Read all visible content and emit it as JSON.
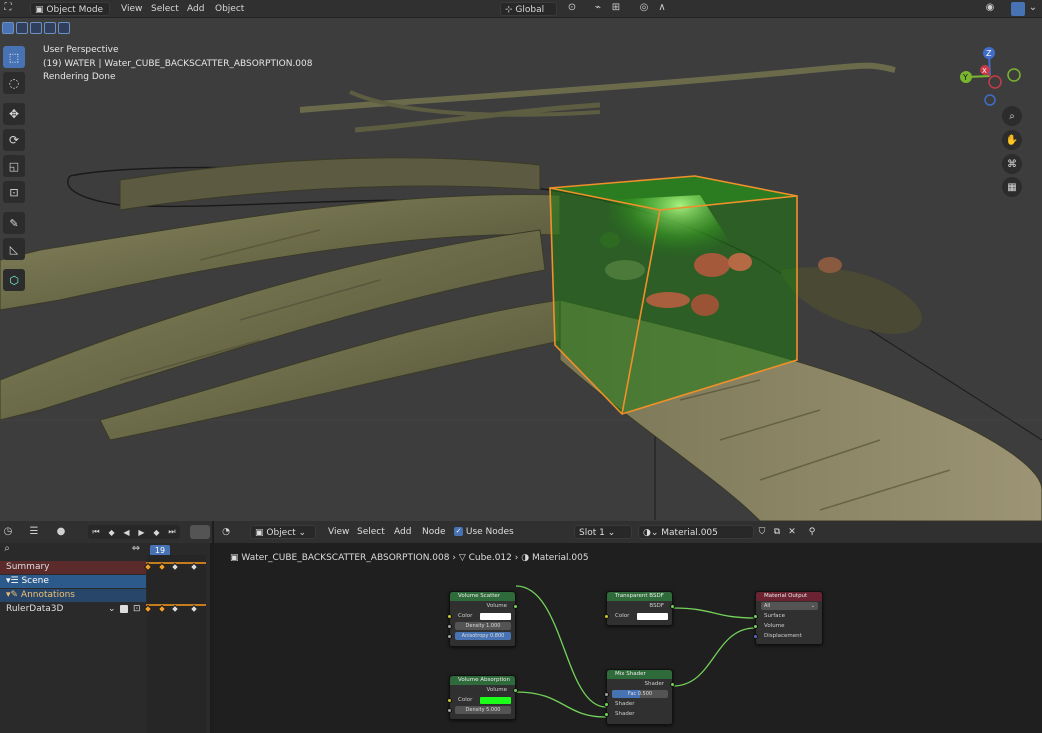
{
  "header": {
    "mode": "Object Mode",
    "menus": [
      "View",
      "Select",
      "Add",
      "Object"
    ],
    "orientation": "Global"
  },
  "viewport": {
    "perspective": "User Perspective",
    "object_info": "(19) WATER | Water_CUBE_BACKSCATTER_ABSORPTION.008",
    "status": "Rendering Done",
    "gizmo": {
      "z": "Z",
      "y": "Y",
      "x": "X"
    },
    "colors": {
      "background": "#3d3d3d",
      "selection_outline": "#f0902a",
      "volume_green": "#1f7a14"
    }
  },
  "timeline": {
    "current_frame": "19",
    "rows": [
      {
        "label": "Summary"
      },
      {
        "label": "Scene"
      },
      {
        "label": "Annotations"
      },
      {
        "label": "RulerData3D"
      }
    ]
  },
  "node_editor": {
    "type": "Object",
    "menus": [
      "View",
      "Select",
      "Add",
      "Node"
    ],
    "use_nodes_label": "Use Nodes",
    "slot": "Slot 1",
    "material": "Material.005",
    "breadcrumb": [
      "Water_CUBE_BACKSCATTER_ABSORPTION.008",
      "Cube.012",
      "Material.005"
    ],
    "nodes": {
      "volume_scatter": {
        "title": "Volume Scatter",
        "output": "Volume",
        "color_label": "Color",
        "density_label": "Density",
        "density_value": "1.000",
        "anisotropy_label": "Anisotropy",
        "anisotropy_value": "0.800"
      },
      "volume_absorption": {
        "title": "Volume Absorption",
        "output": "Volume",
        "color_label": "Color",
        "density_label": "Density",
        "density_value": "5.000"
      },
      "transparent_bsdf": {
        "title": "Transparent BSDF",
        "output": "BSDF",
        "color_label": "Color"
      },
      "mix_shader": {
        "title": "Mix Shader",
        "output": "Shader",
        "fac_label": "Fac",
        "fac_value": "0.500",
        "shader1": "Shader",
        "shader2": "Shader"
      },
      "material_output": {
        "title": "Material Output",
        "target": "All",
        "surface": "Surface",
        "volume": "Volume",
        "displacement": "Displacement"
      }
    }
  }
}
